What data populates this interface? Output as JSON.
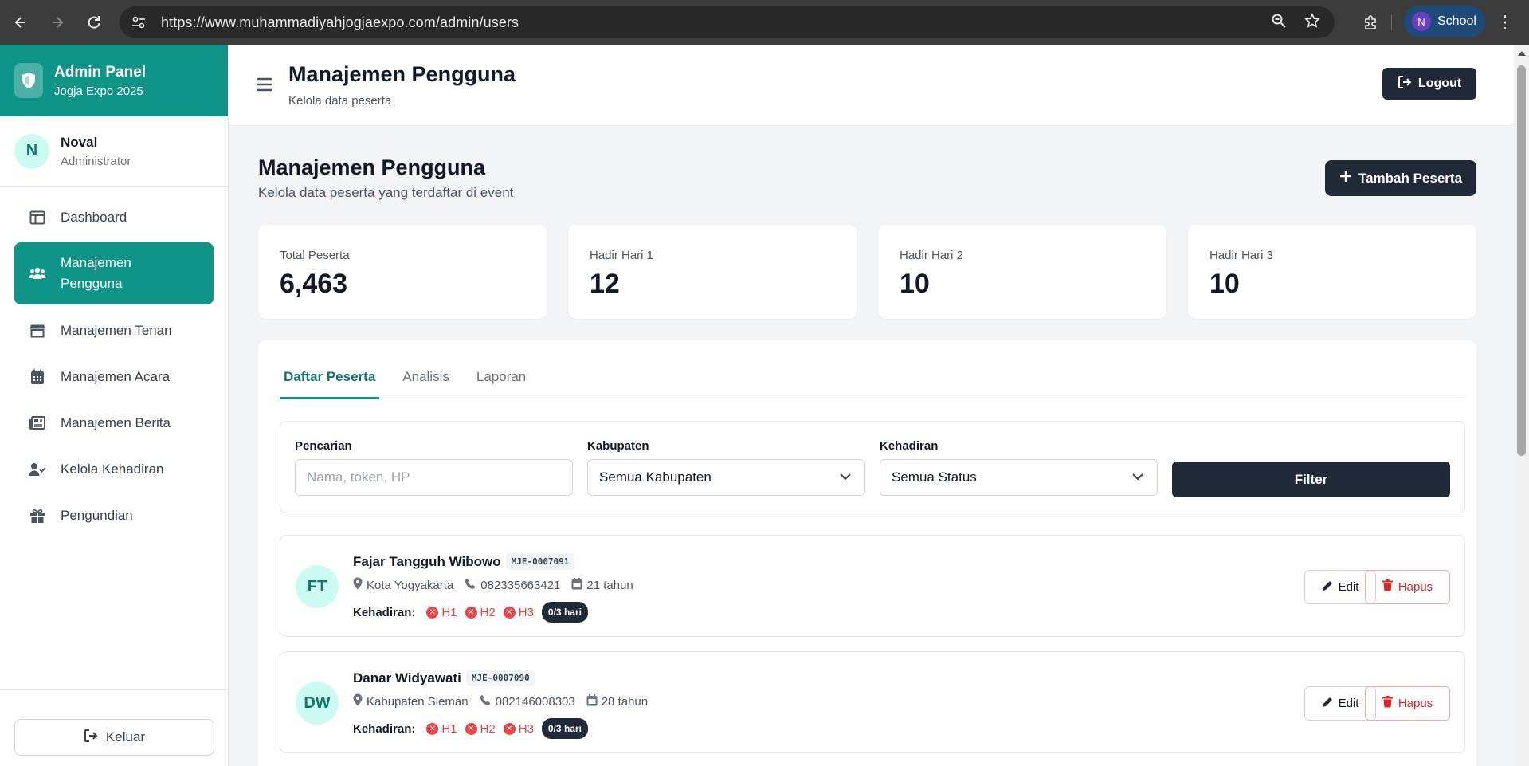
{
  "browser": {
    "url": "https://www.muhammadiyahjogjaexpo.com/admin/users",
    "profile_initial": "N",
    "profile_label": "School"
  },
  "sidebar": {
    "brand_title": "Admin Panel",
    "brand_subtitle": "Jogja Expo 2025",
    "user": {
      "initial": "N",
      "name": "Noval",
      "role": "Administrator"
    },
    "items": [
      {
        "label": "Dashboard",
        "icon": "dashboard-icon"
      },
      {
        "label": "Manajemen\nPengguna",
        "icon": "users-icon",
        "active": true
      },
      {
        "label": "Manajemen Tenan",
        "icon": "store-icon"
      },
      {
        "label": "Manajemen Acara",
        "icon": "calendar-icon"
      },
      {
        "label": "Manajemen Berita",
        "icon": "newspaper-icon"
      },
      {
        "label": "Kelola Kehadiran",
        "icon": "user-check-icon"
      },
      {
        "label": "Pengundian",
        "icon": "gift-icon"
      }
    ],
    "logout_label": "Keluar"
  },
  "header": {
    "title": "Manajemen Pengguna",
    "subtitle": "Kelola data peserta",
    "logout_label": "Logout"
  },
  "main": {
    "title": "Manajemen Pengguna",
    "subtitle": "Kelola data peserta yang terdaftar di event",
    "add_button": "Tambah Peserta",
    "stats": [
      {
        "label": "Total Peserta",
        "value": "6,463"
      },
      {
        "label": "Hadir Hari 1",
        "value": "12"
      },
      {
        "label": "Hadir Hari 2",
        "value": "10"
      },
      {
        "label": "Hadir Hari 3",
        "value": "10"
      }
    ],
    "tabs": [
      {
        "label": "Daftar Peserta",
        "active": true
      },
      {
        "label": "Analisis"
      },
      {
        "label": "Laporan"
      }
    ],
    "filters": {
      "search_label": "Pencarian",
      "search_placeholder": "Nama, token, HP",
      "kabupaten_label": "Kabupaten",
      "kabupaten_value": "Semua Kabupaten",
      "kehadiran_label": "Kehadiran",
      "kehadiran_value": "Semua Status",
      "filter_button": "Filter"
    },
    "participants": [
      {
        "initials": "FT",
        "name": "Fajar Tangguh Wibowo",
        "token": "MJE-0007091",
        "location": "Kota Yogyakarta",
        "phone": "082335663421",
        "age": "21 tahun",
        "attendance_label": "Kehadiran:",
        "days": [
          "H1",
          "H2",
          "H3"
        ],
        "summary": "0/3 hari",
        "edit_label": "Edit",
        "delete_label": "Hapus"
      },
      {
        "initials": "DW",
        "name": "Danar Widyawati",
        "token": "MJE-0007090",
        "location": "Kabupaten Sleman",
        "phone": "082146008303",
        "age": "28 tahun",
        "attendance_label": "Kehadiran:",
        "days": [
          "H1",
          "H2",
          "H3"
        ],
        "summary": "0/3 hari",
        "edit_label": "Edit",
        "delete_label": "Hapus"
      }
    ]
  },
  "colors": {
    "accent": "#0f9488",
    "dark": "#1f2937",
    "danger": "#ef4444"
  }
}
